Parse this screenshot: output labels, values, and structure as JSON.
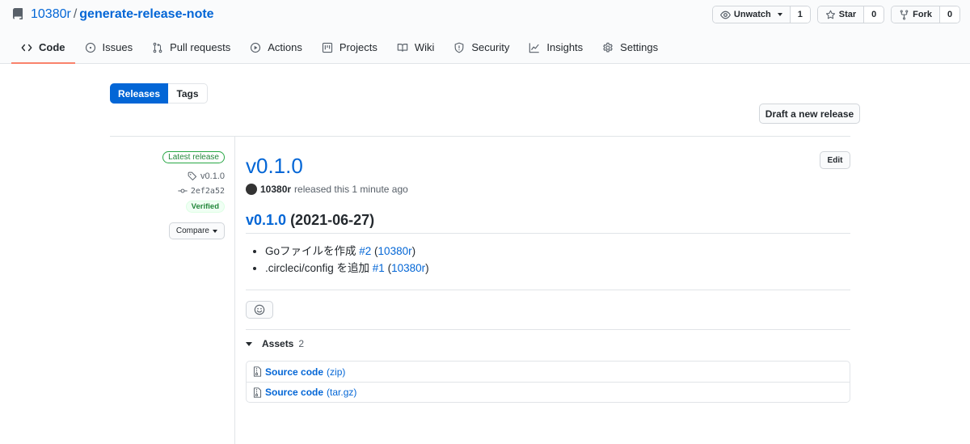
{
  "repo": {
    "owner": "10380r",
    "separator": "/",
    "name": "generate-release-note"
  },
  "actions": {
    "watch": {
      "label": "Unwatch",
      "count": "1"
    },
    "star": {
      "label": "Star",
      "count": "0"
    },
    "fork": {
      "label": "Fork",
      "count": "0"
    }
  },
  "tabs": [
    {
      "label": "Code",
      "icon": "code-icon",
      "active": true
    },
    {
      "label": "Issues",
      "icon": "issue-icon"
    },
    {
      "label": "Pull requests",
      "icon": "pull-request-icon"
    },
    {
      "label": "Actions",
      "icon": "play-icon"
    },
    {
      "label": "Projects",
      "icon": "project-icon"
    },
    {
      "label": "Wiki",
      "icon": "book-icon"
    },
    {
      "label": "Security",
      "icon": "shield-icon"
    },
    {
      "label": "Insights",
      "icon": "graph-icon"
    },
    {
      "label": "Settings",
      "icon": "gear-icon"
    }
  ],
  "subnav": {
    "releases": "Releases",
    "tags": "Tags"
  },
  "draft_button": "Draft a new release",
  "release": {
    "latest_label": "Latest release",
    "tag": "v0.1.0",
    "commit": "2ef2a52",
    "verified": "Verified",
    "compare": "Compare",
    "title": "v0.1.0",
    "edit": "Edit",
    "author": "10380r",
    "released_text": "released this 1 minute ago",
    "heading_version": "v0.1.0",
    "heading_date": "(2021-06-27)",
    "notes": [
      {
        "text": "Goファイルを作成 ",
        "pr": "#2",
        "open": " (",
        "user": "10380r",
        "close": ")"
      },
      {
        "text": ".circleci/config を追加 ",
        "pr": "#1",
        "open": " (",
        "user": "10380r",
        "close": ")"
      }
    ],
    "assets_label": "Assets",
    "assets_count": "2",
    "assets": [
      {
        "name": "Source code",
        "format": "(zip)"
      },
      {
        "name": "Source code",
        "format": "(tar.gz)"
      }
    ]
  }
}
